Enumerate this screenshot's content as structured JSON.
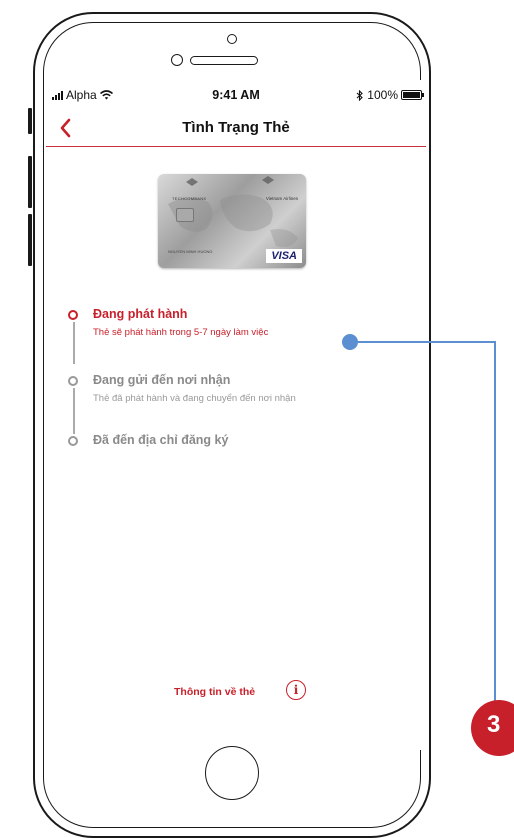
{
  "status_bar": {
    "carrier": "Alpha",
    "time": "9:41 AM",
    "battery": "100%",
    "bluetooth_icon": "bluetooth-icon",
    "wifi_icon": "wifi-icon"
  },
  "nav": {
    "title": "Tình Trạng Thẻ",
    "back_icon": "chevron-left-icon"
  },
  "card": {
    "bank": "TECHCOMBANK",
    "airline": "Vietnam Airlines",
    "holder": "NGUYEN MINH HUONG",
    "network": "VISA"
  },
  "timeline": [
    {
      "title": "Đang phát hành",
      "desc": "Thẻ sẽ phát hành trong 5-7 ngày làm việc",
      "active": true
    },
    {
      "title": "Đang gửi đến nơi nhận",
      "desc": "Thẻ đã phát hành và đang chuyển đến nơi nhận",
      "active": false
    },
    {
      "title": "Đã đến địa chỉ đăng ký",
      "desc": "",
      "active": false
    }
  ],
  "info": {
    "label": "Thông tin về thẻ",
    "icon": "i"
  },
  "annotation": {
    "badge": "3"
  },
  "colors": {
    "accent": "#c8202b",
    "callout": "#5b8fd2",
    "inactive": "#8a8a8a"
  }
}
